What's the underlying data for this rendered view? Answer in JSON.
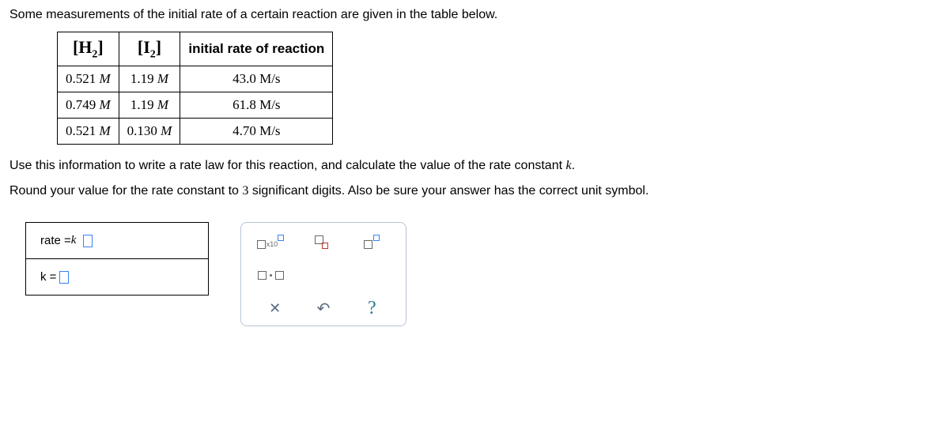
{
  "intro": "Some measurements of the initial rate of a certain reaction are given in the table below.",
  "headers": {
    "h2": "H",
    "h2_sub": "2",
    "i2": "I",
    "i2_sub": "2",
    "rate": "initial rate of reaction"
  },
  "rows": [
    {
      "h2": "0.521",
      "i2": "1.19",
      "rate": "43.0"
    },
    {
      "h2": "0.749",
      "i2": "1.19",
      "rate": "61.8"
    },
    {
      "h2": "0.521",
      "i2": "0.130",
      "rate": "4.70"
    }
  ],
  "unitM": "M",
  "unitRate": "M/s",
  "instr1_a": "Use this information to write a rate law for this reaction, and calculate the value of the rate constant ",
  "instr1_k": "k",
  "instr1_b": ".",
  "instr2_a": "Round your value for the rate constant to ",
  "instr2_n": "3",
  "instr2_b": " significant digits. Also be sure your answer has the correct unit symbol.",
  "ans": {
    "rate_prefix": "rate = ",
    "rate_k": "k",
    "k_prefix": "k = "
  },
  "tool": {
    "x10": "x10",
    "clear": "✕",
    "reset": "↶",
    "help": "?"
  }
}
